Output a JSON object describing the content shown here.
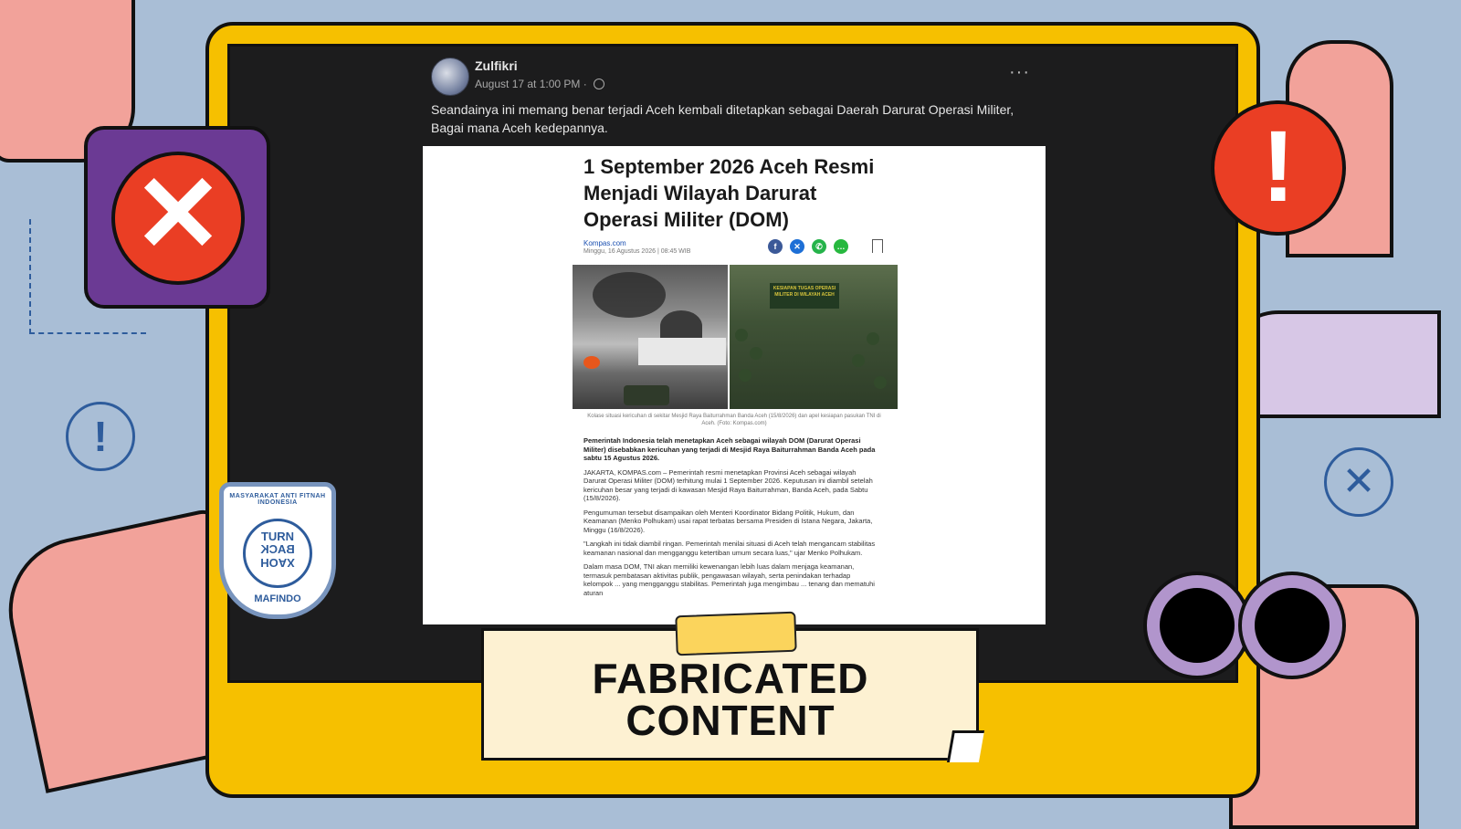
{
  "post": {
    "author": "Zulfikri",
    "timestamp": "August 17 at 1:00 PM · ",
    "more_icon": "···",
    "caption": "Seandainya ini memang benar terjadi Aceh kembali ditetapkan sebagai Daerah Darurat Operasi Militer, Bagai mana Aceh kedepannya."
  },
  "article": {
    "headline": "1 September 2026 Aceh Resmi Menjadi Wilayah Darurat Operasi Militer (DOM)",
    "source": "Kompas.com",
    "date": "Minggu, 16 Agustus 2026 | 08:45 WIB",
    "share_icons": [
      "facebook-icon",
      "x-icon",
      "whatsapp-icon",
      "line-icon"
    ],
    "banner_text": "KESIAPAN TUGAS OPERASI MILITER DI WILAYAH ACEH",
    "photo_caption": "Kolase situasi kericuhan di sekitar Mesjid Raya Baiturrahman Banda Aceh (15/8/2026) dan apel kesiapan pasukan TNI di Aceh. (Foto: Kompas.com)",
    "lead": "Pemerintah Indonesia telah menetapkan Aceh sebagai wilayah DOM (Darurat Operasi Militer) disebabkan kericuhan yang terjadi di Mesjid Raya Baiturrahman Banda Aceh pada sabtu 15 Agustus 2026.",
    "paragraphs": [
      "JAKARTA, KOMPAS.com – Pemerintah resmi menetapkan Provinsi Aceh sebagai wilayah Darurat Operasi Militer (DOM) terhitung mulai 1 September 2026. Keputusan ini diambil setelah kericuhan besar yang terjadi di kawasan Mesjid Raya Baiturrahman, Banda Aceh, pada Sabtu (15/8/2026).",
      "Pengumuman tersebut disampaikan oleh Menteri Koordinator Bidang Politik, Hukum, dan Keamanan (Menko Polhukam) usai rapat terbatas bersama Presiden di Istana Negara, Jakarta, Minggu (16/8/2026).",
      "\"Langkah ini tidak diambil ringan. Pemerintah menilai situasi di Aceh telah mengancam stabilitas keamanan nasional dan mengganggu ketertiban umum secara luas,\" ujar Menko Polhukam.",
      "Dalam masa DOM, TNI akan memiliki kewenangan lebih luas dalam menjaga keamanan, termasuk pembatasan aktivitas publik, pengawasan wilayah, serta penindakan terhadap kelompok ... yang mengganggu stabilitas. Pemerintah juga mengimbau ... tenang dan mematuhi aturan"
    ]
  },
  "label": {
    "line1": "FABRICATED",
    "line2": "CONTENT"
  },
  "logo": {
    "ring_text": "MASYARAKAT ANTI FITNAH INDONESIA",
    "core_line1": "TURN",
    "core_line2": "BACK",
    "core_line3": "HOAX",
    "bottom_text": "MAFINDO"
  },
  "colors": {
    "frame": "#f6c000",
    "screen": "#1c1c1d",
    "background": "#a9bed6",
    "alert_red": "#ea3e24",
    "badge_purple": "#6b3a94",
    "label_bg": "#fdf1d2"
  }
}
